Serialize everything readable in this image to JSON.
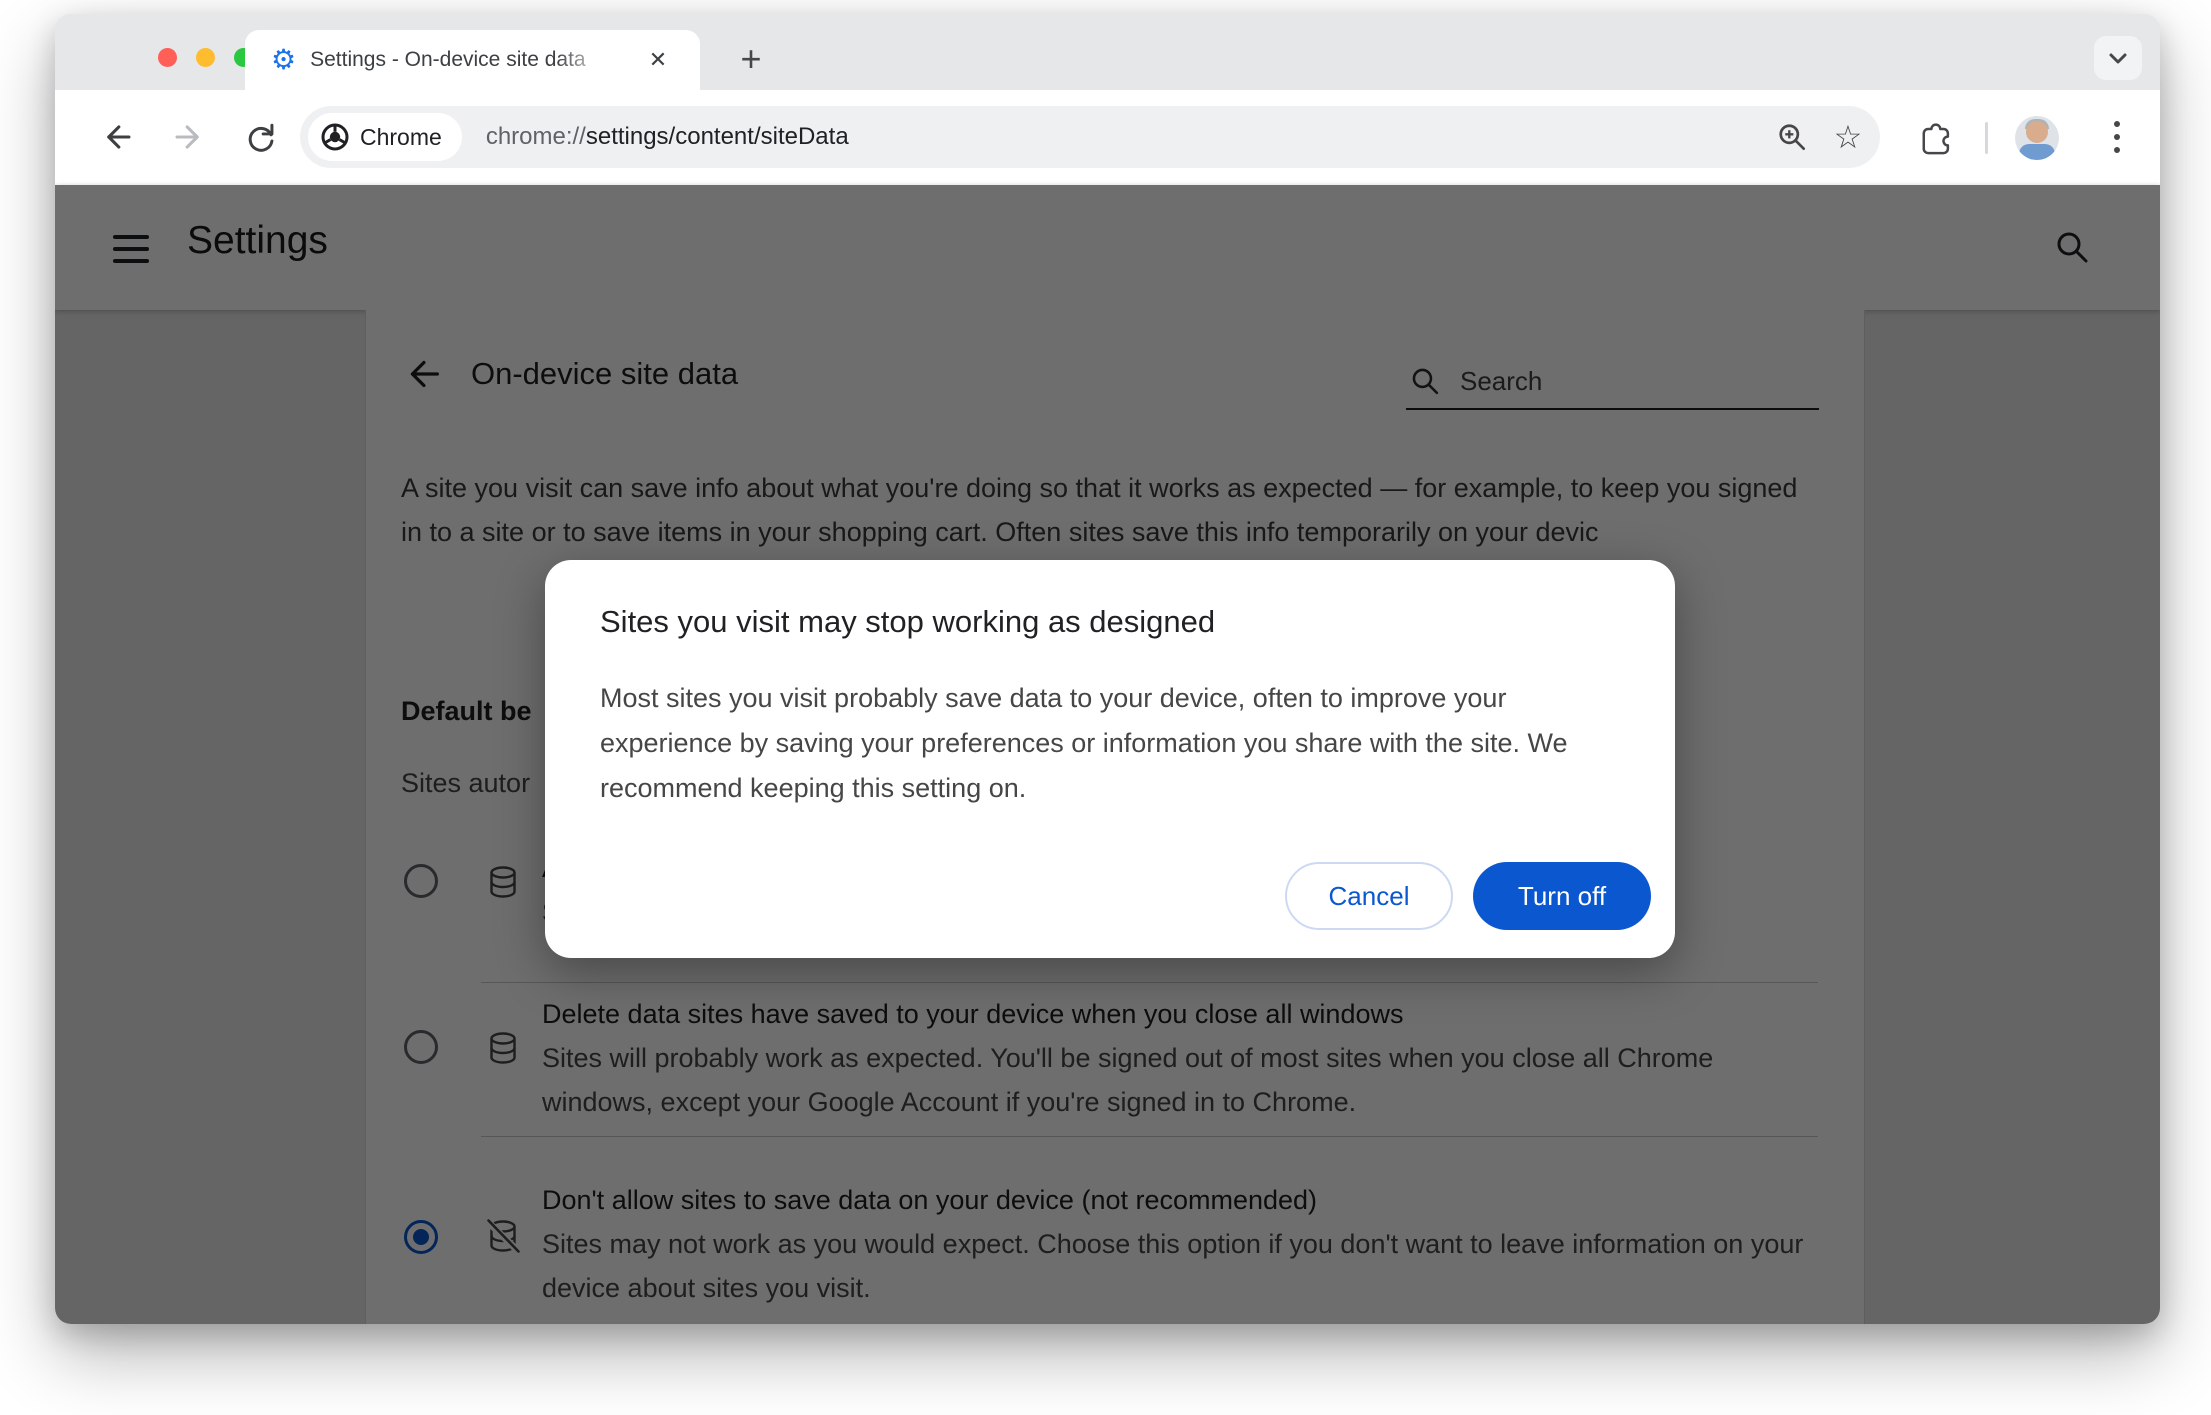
{
  "colors": {
    "accent_blue": "#0b57d0",
    "favicon_blue": "#1a73e8",
    "traffic_red": "#ff5f57",
    "traffic_yellow": "#febc2e",
    "traffic_green": "#2ac840",
    "scrim": "rgba(0,0,0,0.57)"
  },
  "window": {
    "tab": {
      "title": "Settings - On-device site data",
      "close_glyph": "✕"
    },
    "new_tab_glyph": "+",
    "toolbar": {
      "chip_label": "Chrome",
      "url_scheme": "chrome://",
      "url_rest": "settings/content/siteData"
    }
  },
  "settings_header": {
    "title": "Settings"
  },
  "page": {
    "title": "On-device site data",
    "search_placeholder": "Search",
    "intro": "A site you visit can save info about what you're doing so that it works as expected — for example, to keep you signed in to a site or to save items in your shopping cart. Often sites save this info temporarily on your devic",
    "default_heading_fragment": "Default be",
    "sites_follow_fragment": "Sites autor",
    "options": [
      {
        "title": "A",
        "subtitle": "S",
        "selected": false,
        "icon": "database"
      },
      {
        "title": "Delete data sites have saved to your device when you close all windows",
        "subtitle": "Sites will probably work as expected. You'll be signed out of most sites when you close all Chrome windows, except your Google Account if you're signed in to Chrome.",
        "selected": false,
        "icon": "database"
      },
      {
        "title": "Don't allow sites to save data on your device (not recommended)",
        "subtitle": "Sites may not work as you would expect. Choose this option if you don't want to leave information on your device about sites you visit.",
        "selected": true,
        "icon": "database-off"
      }
    ]
  },
  "dialog": {
    "title": "Sites you visit may stop working as designed",
    "body": "Most sites you visit probably save data to your device, often to improve your experience by saving your preferences or information you share with the site. We recommend keeping this setting on.",
    "cancel_label": "Cancel",
    "confirm_label": "Turn off"
  }
}
